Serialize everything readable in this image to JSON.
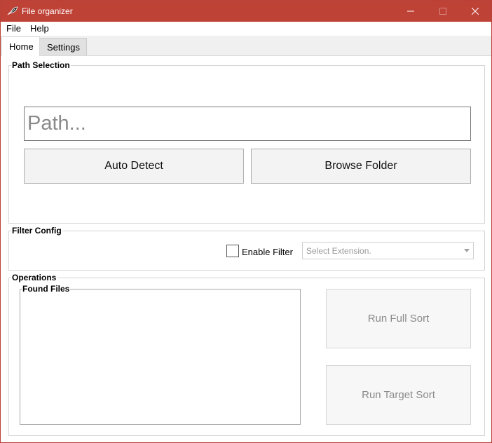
{
  "window": {
    "title": "File organizer",
    "accent_color": "#bf4237",
    "icon": "app-feather-icon"
  },
  "menu": {
    "items": [
      {
        "label": "File"
      },
      {
        "label": "Help"
      }
    ]
  },
  "tabs": [
    {
      "label": "Home",
      "active": true
    },
    {
      "label": "Settings",
      "active": false
    }
  ],
  "path_selection": {
    "title": "Path Selection",
    "input_placeholder": "Path...",
    "input_value": "",
    "auto_detect_label": "Auto Detect",
    "browse_label": "Browse Folder"
  },
  "filter_config": {
    "title": "Filter Config",
    "enable_label": "Enable Filter",
    "enabled": false,
    "select_placeholder": "Select Extension."
  },
  "operations": {
    "title": "Operations",
    "found_files_title": "Found Files",
    "found_files": [],
    "run_full_label": "Run Full Sort",
    "run_target_label": "Run Target Sort"
  }
}
